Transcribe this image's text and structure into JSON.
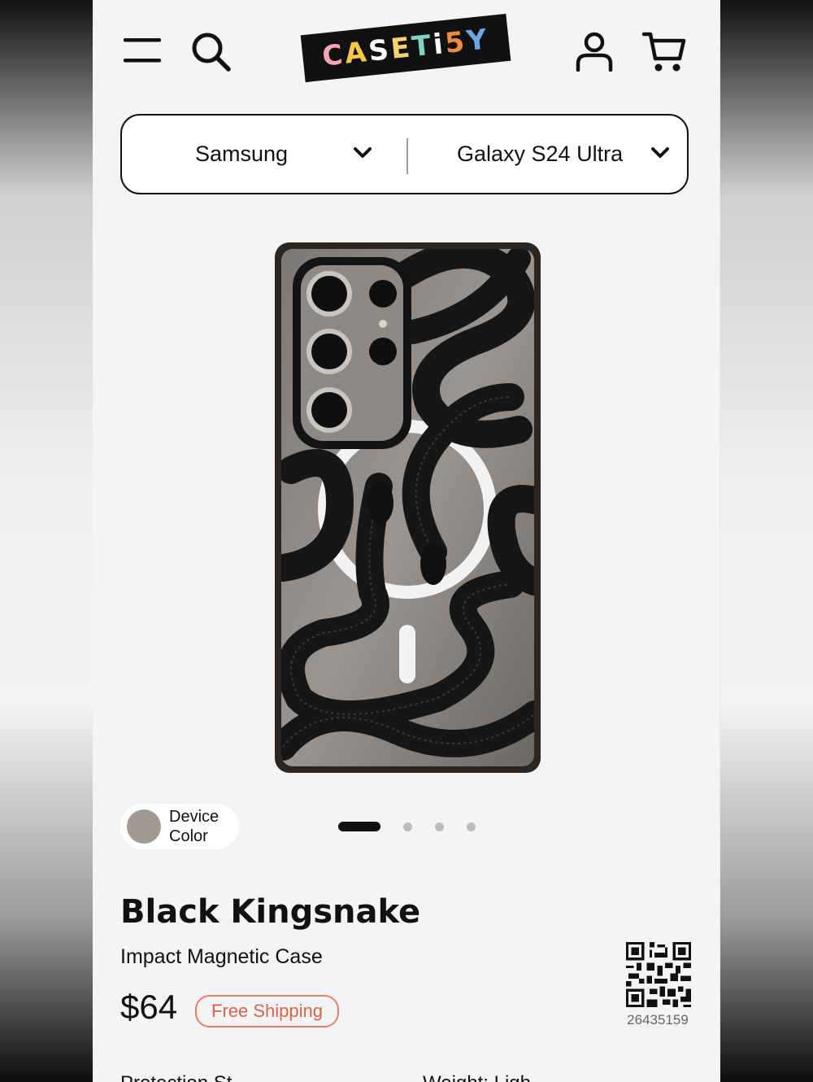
{
  "brand": {
    "logo_letters": [
      "C",
      "A",
      "S",
      "E",
      "T",
      "i",
      "5",
      "Y"
    ],
    "logo_colors": [
      "#f6a4b6",
      "#f5c84a",
      "#ffffff",
      "#f3d36b",
      "#7fd3c1",
      "#ffffff",
      "#f08a3c",
      "#6fa6e8"
    ]
  },
  "header": {
    "menu_icon": "hamburger-menu-icon",
    "search_icon": "search-icon",
    "account_icon": "user-icon",
    "cart_icon": "cart-icon"
  },
  "selector": {
    "brand": "Samsung",
    "model": "Galaxy S24 Ultra"
  },
  "gallery": {
    "dot_count": 4,
    "active_index": 0
  },
  "device_color": {
    "label_line1": "Device",
    "label_line2": "Color",
    "swatch_color": "#a29a90"
  },
  "product": {
    "title": "Black Kingsnake",
    "subtitle": "Impact Magnetic Case",
    "price": "$64",
    "shipping_badge": "Free Shipping",
    "product_code": "26435159"
  },
  "specs": {
    "left_label": "Protection St",
    "right_label": "Weight: Ligh"
  },
  "colors": {
    "accent_badge": "#d9624a",
    "text": "#111111",
    "background": "#f4f4f4"
  }
}
